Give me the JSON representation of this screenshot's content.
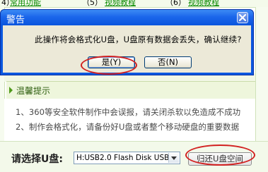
{
  "top_tabs": {
    "item4_prefix": "4）",
    "item4_label": "常用功能",
    "item5_prefix": "（5）",
    "item5_label": "视频教程",
    "item6_prefix": "（6）",
    "item6_label": "视频教程"
  },
  "tips": {
    "header": "温馨提示",
    "lines": [
      "1、360等安全软件制作中会误报，请关闭杀软以免造成不成功",
      "2、制作会格式化，请备份好U盘或者整个移动硬盘的重要数据"
    ]
  },
  "bottom": {
    "disk_label": "请选择U盘:",
    "disk_selected": "H:USB2.0 Flash Disk USB I",
    "restore_label": "归还U盘空间"
  },
  "dialog": {
    "title": "警告",
    "message": "此操作将会格式化U盘，U盘原有数据会丢失，确认继续?",
    "yes_label": "是(Y)",
    "no_label": "否(N)"
  },
  "colors": {
    "dialog_title": "#1b66eb",
    "dialog_body": "#ece9d8",
    "highlight_ring": "#d22020",
    "app_accent": "#4f9a1a"
  }
}
